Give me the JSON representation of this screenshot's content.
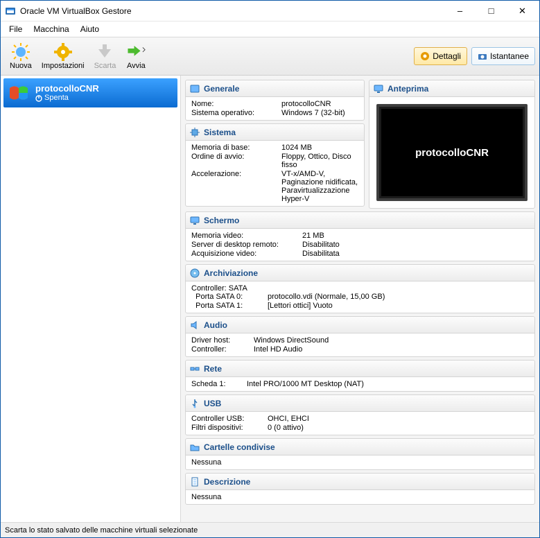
{
  "window": {
    "title": "Oracle VM VirtualBox Gestore"
  },
  "menu": {
    "file": "File",
    "machine": "Macchina",
    "help": "Aiuto"
  },
  "toolbar": {
    "new": "Nuova",
    "settings": "Impostazioni",
    "discard": "Scarta",
    "start": "Avvia",
    "details": "Dettagli",
    "snapshots": "Istantanee"
  },
  "vm": {
    "name": "protocolloCNR",
    "state": "Spenta"
  },
  "sections": {
    "general": {
      "title": "Generale",
      "name_k": "Nome:",
      "name_v": "protocolloCNR",
      "os_k": "Sistema operativo:",
      "os_v": "Windows 7 (32-bit)"
    },
    "system": {
      "title": "Sistema",
      "mem_k": "Memoria di base:",
      "mem_v": "1024 MB",
      "boot_k": "Ordine di avvio:",
      "boot_v": "Floppy, Ottico, Disco fisso",
      "accel_k": "Accelerazione:",
      "accel_v": "VT-x/AMD-V, Paginazione nidificata, Paravirtualizzazione Hyper-V"
    },
    "preview": {
      "title": "Anteprima",
      "label": "protocolloCNR"
    },
    "display": {
      "title": "Schermo",
      "vram_k": "Memoria video:",
      "vram_v": "21 MB",
      "rdp_k": "Server di desktop remoto:",
      "rdp_v": "Disabilitato",
      "cap_k": "Acquisizione video:",
      "cap_v": "Disabilitata"
    },
    "storage": {
      "title": "Archiviazione",
      "ctrl": "Controller: SATA",
      "p0_k": "  Porta SATA 0:",
      "p0_v": "protocollo.vdi (Normale, 15,00 GB)",
      "p1_k": "  Porta SATA 1:",
      "p1_v": "[Lettori ottici] Vuoto"
    },
    "audio": {
      "title": "Audio",
      "drv_k": "Driver host:",
      "drv_v": "Windows DirectSound",
      "ctl_k": "Controller:",
      "ctl_v": "Intel HD Audio"
    },
    "network": {
      "title": "Rete",
      "a1_k": "Scheda 1:",
      "a1_v": "Intel PRO/1000 MT Desktop (NAT)"
    },
    "usb": {
      "title": "USB",
      "c_k": "Controller USB:",
      "c_v": "OHCI, EHCI",
      "f_k": "Filtri dispositivi:",
      "f_v": "0 (0 attivo)"
    },
    "shared": {
      "title": "Cartelle condivise",
      "none": "Nessuna"
    },
    "desc": {
      "title": "Descrizione",
      "none": "Nessuna"
    }
  },
  "status": "Scarta lo stato salvato delle macchine virtuali selezionate"
}
